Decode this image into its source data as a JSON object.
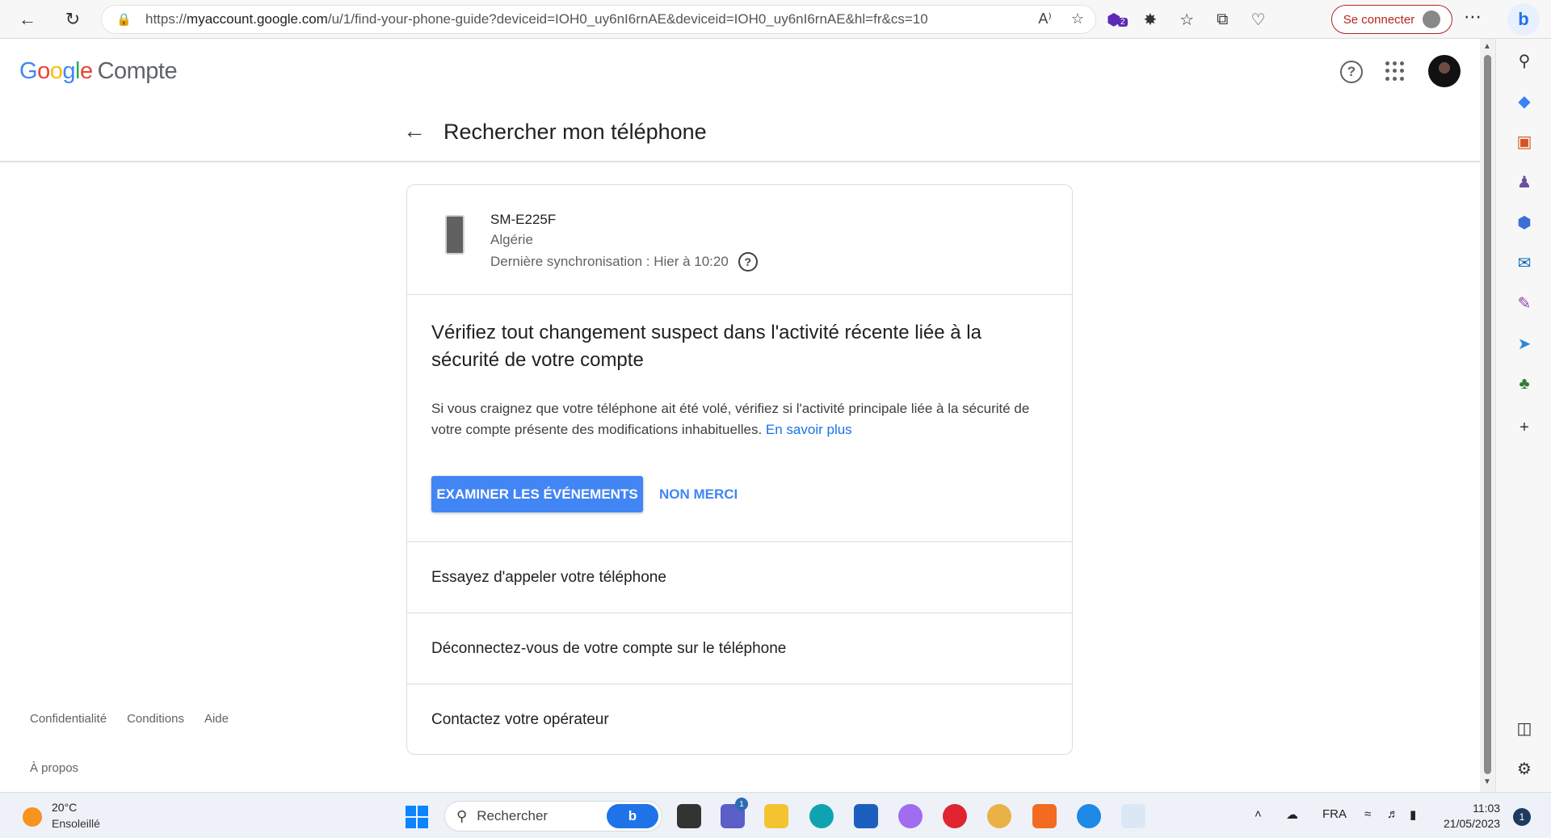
{
  "browser": {
    "url_prefix": "https://",
    "url_host": "myaccount.google.com",
    "url_path": "/u/1/find-your-phone-guide?deviceid=IOH0_uy6nI6rnAE&deviceid=IOH0_uy6nI6rnAE&hl=fr&cs=10",
    "signin_label": "Se connecter",
    "extension_badge": "2"
  },
  "header": {
    "logo_letters": [
      "G",
      "o",
      "o",
      "g",
      "l",
      "e"
    ],
    "product": "Compte",
    "page_title": "Rechercher mon téléphone"
  },
  "device": {
    "name": "SM-E225F",
    "country": "Algérie",
    "last_sync": "Dernière synchronisation : Hier à 10:20"
  },
  "alert": {
    "title": "Vérifiez tout changement suspect dans l'activité récente liée à la sécurité de votre compte",
    "description": "Si vous craignez que votre téléphone ait été volé, vérifiez si l'activité principale liée à la sécurité de votre compte présente des modifications inhabituelles.",
    "learn_more": "En savoir plus",
    "primary_button": "EXAMINER LES ÉVÉNEMENTS",
    "secondary_button": "NON MERCI"
  },
  "options": [
    "Essayez d'appeler votre téléphone",
    "Déconnectez-vous de votre compte sur le téléphone",
    "Contactez votre opérateur"
  ],
  "footer": {
    "privacy": "Confidentialité",
    "terms": "Conditions",
    "help": "Aide",
    "about": "À propos"
  },
  "taskbar": {
    "temperature": "20°C",
    "weather": "Ensoleillé",
    "search_placeholder": "Rechercher",
    "teams_badge": "1",
    "language": "FRA",
    "time": "11:03",
    "date": "21/05/2023",
    "notification_count": "1"
  },
  "colors": {
    "google_blue": "#4285f4",
    "link_blue": "#1a73e8",
    "signin_red": "#b3261e"
  }
}
